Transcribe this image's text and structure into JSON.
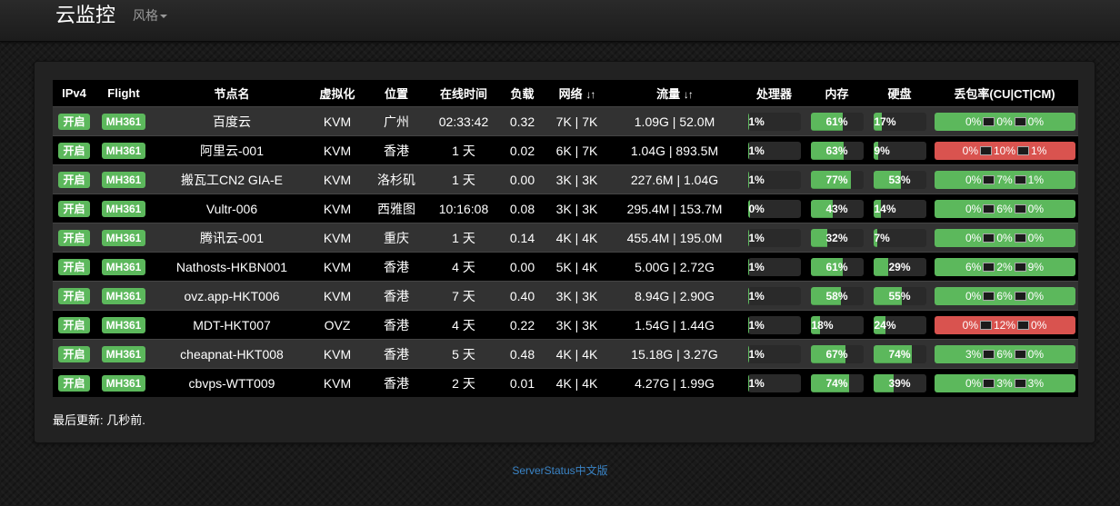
{
  "navbar": {
    "brand": "云监控",
    "style_menu": "风格"
  },
  "table": {
    "headers": {
      "ipv4": "IPv4",
      "flight": "Flight",
      "name": "节点名",
      "virt": "虚拟化",
      "location": "位置",
      "uptime": "在线时间",
      "load": "负载",
      "network": "网络",
      "traffic": "流量",
      "cpu": "处理器",
      "memory": "内存",
      "disk": "硬盘",
      "loss": "丢包率(CU|CT|CM)"
    },
    "sort_icon": "↓↑",
    "rows": [
      {
        "ipv4": "开启",
        "flight": "MH361",
        "name": "百度云",
        "virt": "KVM",
        "location": "广州",
        "uptime": "02:33:42",
        "load": "0.32",
        "network": "7K | 7K",
        "traffic": "1.09G | 52.0M",
        "cpu": {
          "label": "1%",
          "value": 1
        },
        "memory": {
          "label": "61%",
          "value": 61
        },
        "disk": {
          "label": "17%",
          "value": 17
        },
        "loss": {
          "cu": "0%",
          "ct": "0%",
          "cm": "0%",
          "status": "ok"
        }
      },
      {
        "ipv4": "开启",
        "flight": "MH361",
        "name": "阿里云-001",
        "virt": "KVM",
        "location": "香港",
        "uptime": "1 天",
        "load": "0.02",
        "network": "6K | 7K",
        "traffic": "1.04G | 893.5M",
        "cpu": {
          "label": "1%",
          "value": 1
        },
        "memory": {
          "label": "63%",
          "value": 63
        },
        "disk": {
          "label": "9%",
          "value": 9
        },
        "loss": {
          "cu": "0%",
          "ct": "10%",
          "cm": "1%",
          "status": "bad"
        }
      },
      {
        "ipv4": "开启",
        "flight": "MH361",
        "name": "搬瓦工CN2 GIA-E",
        "virt": "KVM",
        "location": "洛杉矶",
        "uptime": "1 天",
        "load": "0.00",
        "network": "3K | 3K",
        "traffic": "227.6M | 1.04G",
        "cpu": {
          "label": "1%",
          "value": 1
        },
        "memory": {
          "label": "77%",
          "value": 77
        },
        "disk": {
          "label": "53%",
          "value": 53
        },
        "loss": {
          "cu": "0%",
          "ct": "7%",
          "cm": "1%",
          "status": "ok"
        }
      },
      {
        "ipv4": "开启",
        "flight": "MH361",
        "name": "Vultr-006",
        "virt": "KVM",
        "location": "西雅图",
        "uptime": "10:16:08",
        "load": "0.08",
        "network": "3K | 3K",
        "traffic": "295.4M | 153.7M",
        "cpu": {
          "label": "0%",
          "value": 0
        },
        "memory": {
          "label": "43%",
          "value": 43
        },
        "disk": {
          "label": "14%",
          "value": 14
        },
        "loss": {
          "cu": "0%",
          "ct": "6%",
          "cm": "0%",
          "status": "ok"
        }
      },
      {
        "ipv4": "开启",
        "flight": "MH361",
        "name": "腾讯云-001",
        "virt": "KVM",
        "location": "重庆",
        "uptime": "1 天",
        "load": "0.14",
        "network": "4K | 4K",
        "traffic": "455.4M | 195.0M",
        "cpu": {
          "label": "1%",
          "value": 1
        },
        "memory": {
          "label": "32%",
          "value": 32
        },
        "disk": {
          "label": "7%",
          "value": 7
        },
        "loss": {
          "cu": "0%",
          "ct": "0%",
          "cm": "0%",
          "status": "ok"
        }
      },
      {
        "ipv4": "开启",
        "flight": "MH361",
        "name": "Nathosts-HKBN001",
        "virt": "KVM",
        "location": "香港",
        "uptime": "4 天",
        "load": "0.00",
        "network": "5K | 4K",
        "traffic": "5.00G | 2.72G",
        "cpu": {
          "label": "1%",
          "value": 1
        },
        "memory": {
          "label": "61%",
          "value": 61
        },
        "disk": {
          "label": "29%",
          "value": 29
        },
        "loss": {
          "cu": "6%",
          "ct": "2%",
          "cm": "9%",
          "status": "ok"
        }
      },
      {
        "ipv4": "开启",
        "flight": "MH361",
        "name": "ovz.app-HKT006",
        "virt": "KVM",
        "location": "香港",
        "uptime": "7 天",
        "load": "0.40",
        "network": "3K | 3K",
        "traffic": "8.94G | 2.90G",
        "cpu": {
          "label": "1%",
          "value": 1
        },
        "memory": {
          "label": "58%",
          "value": 58
        },
        "disk": {
          "label": "55%",
          "value": 55
        },
        "loss": {
          "cu": "0%",
          "ct": "6%",
          "cm": "0%",
          "status": "ok"
        }
      },
      {
        "ipv4": "开启",
        "flight": "MH361",
        "name": "MDT-HKT007",
        "virt": "OVZ",
        "location": "香港",
        "uptime": "4 天",
        "load": "0.22",
        "network": "3K | 3K",
        "traffic": "1.54G | 1.44G",
        "cpu": {
          "label": "1%",
          "value": 1
        },
        "memory": {
          "label": "18%",
          "value": 18
        },
        "disk": {
          "label": "24%",
          "value": 24
        },
        "loss": {
          "cu": "0%",
          "ct": "12%",
          "cm": "0%",
          "status": "bad"
        }
      },
      {
        "ipv4": "开启",
        "flight": "MH361",
        "name": "cheapnat-HKT008",
        "virt": "KVM",
        "location": "香港",
        "uptime": "5 天",
        "load": "0.48",
        "network": "4K | 4K",
        "traffic": "15.18G | 3.27G",
        "cpu": {
          "label": "1%",
          "value": 1
        },
        "memory": {
          "label": "67%",
          "value": 67
        },
        "disk": {
          "label": "74%",
          "value": 74
        },
        "loss": {
          "cu": "3%",
          "ct": "6%",
          "cm": "0%",
          "status": "ok"
        }
      },
      {
        "ipv4": "开启",
        "flight": "MH361",
        "name": "cbvps-WTT009",
        "virt": "KVM",
        "location": "香港",
        "uptime": "2 天",
        "load": "0.01",
        "network": "4K | 4K",
        "traffic": "4.27G | 1.99G",
        "cpu": {
          "label": "1%",
          "value": 1
        },
        "memory": {
          "label": "74%",
          "value": 74
        },
        "disk": {
          "label": "39%",
          "value": 39
        },
        "loss": {
          "cu": "0%",
          "ct": "3%",
          "cm": "3%",
          "status": "ok"
        }
      }
    ]
  },
  "updated": "最后更新: 几秒前.",
  "footer": {
    "link": "ServerStatus中文版"
  },
  "colors": {
    "green": "#5cb85c",
    "red": "#d9534f",
    "link": "#3a84c6"
  },
  "icons": {
    "loss_separator": "monitor-icon",
    "menu": "caret-down-icon",
    "sort": "sort-arrows-icon"
  }
}
